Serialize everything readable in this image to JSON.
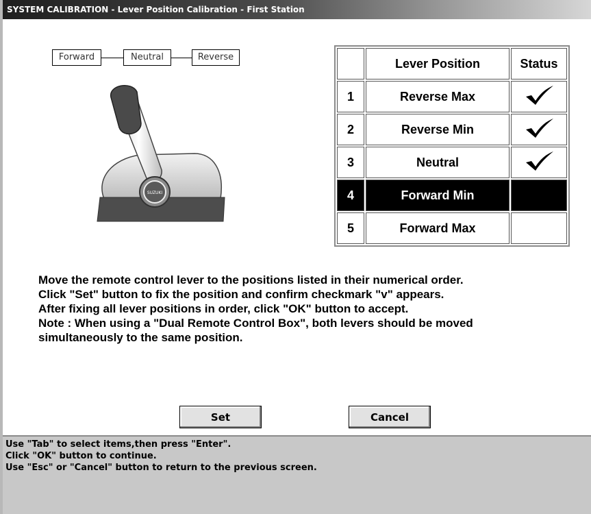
{
  "window": {
    "title": "SYSTEM CALIBRATION  - Lever Position Calibration - First Station"
  },
  "positions": [
    "Forward",
    "Neutral",
    "Reverse"
  ],
  "table": {
    "headers": [
      "",
      "Lever Position",
      "Status"
    ],
    "rows": [
      {
        "num": "1",
        "label": "Reverse Max",
        "checked": true,
        "selected": false
      },
      {
        "num": "2",
        "label": "Reverse Min",
        "checked": true,
        "selected": false
      },
      {
        "num": "3",
        "label": "Neutral",
        "checked": true,
        "selected": false
      },
      {
        "num": "4",
        "label": "Forward Min",
        "checked": false,
        "selected": true
      },
      {
        "num": "5",
        "label": "Forward Max",
        "checked": false,
        "selected": false
      }
    ]
  },
  "instructions": [
    "Move the remote control lever to the positions listed in their numerical order.",
    "Click \"Set\" button to fix the position and confirm checkmark \"v\" appears.",
    "After fixing all lever positions in order, click \"OK\" button to accept.",
    "Note : When using a \"Dual Remote Control Box\", both levers should be moved",
    "simultaneously to the same position."
  ],
  "buttons": {
    "set": "Set",
    "cancel": "Cancel"
  },
  "help": [
    "Use \"Tab\" to select items,then press \"Enter\".",
    "Click \"OK\" button to continue.",
    "Use \"Esc\" or \"Cancel\" button to return to the previous screen."
  ],
  "lever_logo": "SUZUKI"
}
